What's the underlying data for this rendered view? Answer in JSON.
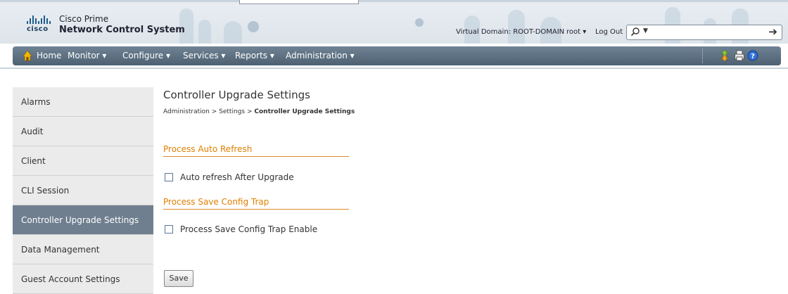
{
  "header": {
    "brand": "cisco",
    "product_line1": "Cisco Prime",
    "product_line2": "Network Control System",
    "virtual_domain": "Virtual Domain: ROOT-DOMAIN",
    "user": "root ▾",
    "logout": "Log Out",
    "search_placeholder": ""
  },
  "nav": {
    "home": "Home",
    "items": [
      "Monitor ▾",
      "Configure ▾",
      "Services ▾",
      "Reports ▾",
      "Administration ▾"
    ],
    "tools": [
      "refresh-icon",
      "print-icon",
      "help-icon"
    ]
  },
  "sidebar": {
    "items": [
      {
        "label": "Alarms",
        "active": false
      },
      {
        "label": "Audit",
        "active": false
      },
      {
        "label": "Client",
        "active": false
      },
      {
        "label": "CLI Session",
        "active": false
      },
      {
        "label": "Controller Upgrade Settings",
        "active": true
      },
      {
        "label": "Data Management",
        "active": false
      },
      {
        "label": "Guest Account Settings",
        "active": false
      }
    ]
  },
  "main": {
    "title": "Controller Upgrade Settings",
    "breadcrumb": [
      "Administration",
      ">",
      "Settings",
      ">",
      "Controller Upgrade Settings"
    ],
    "sections": [
      {
        "title": "Process Auto Refresh",
        "checkbox_label": "Auto refresh After Upgrade",
        "checked": false
      },
      {
        "title": "Process Save Config Trap",
        "checkbox_label": "Process Save Config Trap Enable",
        "checked": false
      }
    ],
    "save_label": "Save"
  },
  "colors": {
    "accent_orange": "#e07f00",
    "nav_bg": "#5a6e80",
    "active_sidebar": "#6f7f8f"
  }
}
